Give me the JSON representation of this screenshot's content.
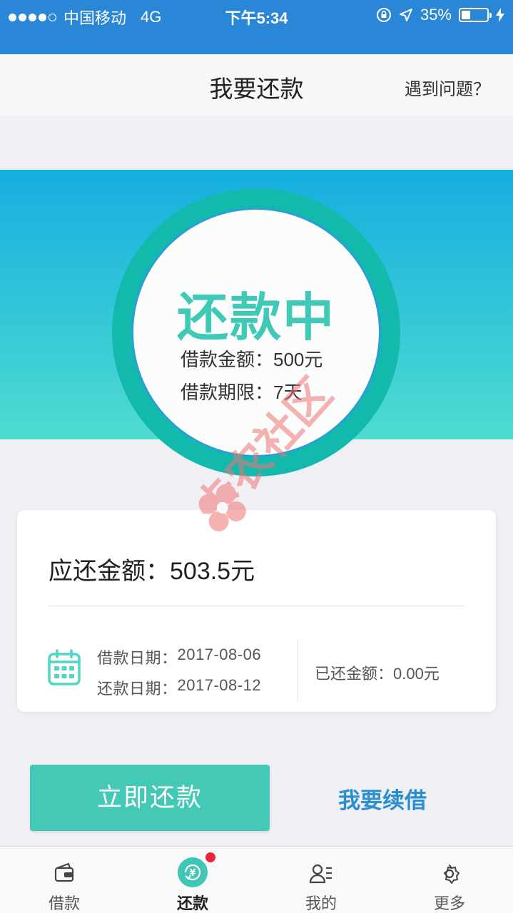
{
  "status_bar": {
    "carrier": "中国移动",
    "network": "4G",
    "time": "下午5:34",
    "battery": "35%",
    "battery_level": 0.35
  },
  "header": {
    "title": "我要还款",
    "help": "遇到问题？"
  },
  "loan_status": {
    "label": "还款中",
    "amount_label": "借款金额：",
    "amount_value": "500元",
    "term_label": "借款期限：",
    "term_value": "7天"
  },
  "watermark": "卡农社区",
  "summary": {
    "due_label": "应还金额：",
    "due_value": "503.5元",
    "loan_date_label": "借款日期：",
    "loan_date": "2017-08-06",
    "repay_date_label": "还款日期：",
    "repay_date": "2017-08-12",
    "repaid_label": "已还金额：",
    "repaid_value": "0.00元"
  },
  "actions": {
    "repay_now": "立即还款",
    "renew": "我要续借"
  },
  "tabbar": {
    "items": [
      {
        "label": "借款",
        "icon": "wallet-icon"
      },
      {
        "label": "还款",
        "icon": "yuan-refresh-icon",
        "active": true,
        "badge": true
      },
      {
        "label": "我的",
        "icon": "profile-icon"
      },
      {
        "label": "更多",
        "icon": "gear-icon"
      }
    ]
  },
  "colors": {
    "status_bar": "#2a86d6",
    "accent": "#44c9b6",
    "ring": "#13b9ac",
    "link": "#2a8fd0",
    "badge": "#e8283a",
    "watermark": "#f07474"
  }
}
